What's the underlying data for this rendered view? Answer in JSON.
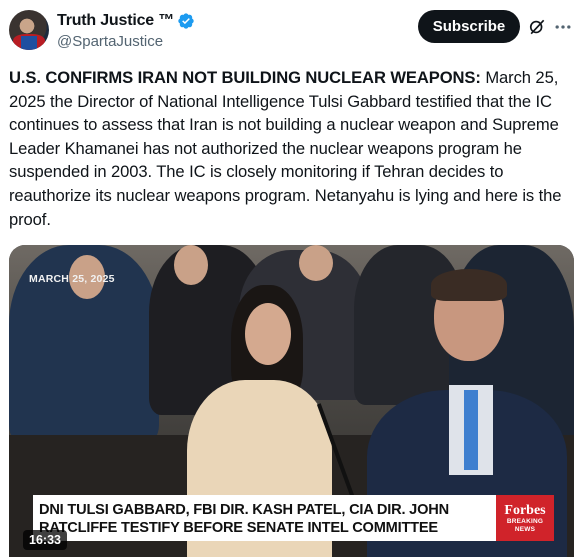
{
  "author": {
    "display_name": "Truth Justice ™",
    "handle": "@SpartaJustice",
    "verified_icon": "verified-badge-icon",
    "verified_color": "#1d9bf0"
  },
  "actions": {
    "subscribe_label": "Subscribe",
    "grok_icon": "grok-icon",
    "more_icon": "more-options-icon"
  },
  "tweet": {
    "headline": "U.S. CONFIRMS IRAN NOT BUILDING NUCLEAR WEAPONS:",
    "body": " March 25, 2025 the Director of National Intelligence Tulsi Gabbard testified that the IC continues to assess that Iran is not building a nuclear weapon and Supreme Leader Khamanei has not authorized the nuclear weapons program he suspended in 2003. The IC is closely monitoring if Tehran decides to reauthorize its nuclear weapons program. Netanyahu is lying and here is the proof."
  },
  "video": {
    "date_overlay": "MARCH 25, 2025",
    "caption": "DNI TULSI GABBARD, FBI DIR. KASH PATEL, CIA DIR. JOHN RATCLIFFE TESTIFY BEFORE SENATE INTEL COMMITTEE",
    "brand": "Forbes",
    "brand_sub": "BREAKING NEWS",
    "brand_color": "#d0232a",
    "duration": "16:33"
  }
}
